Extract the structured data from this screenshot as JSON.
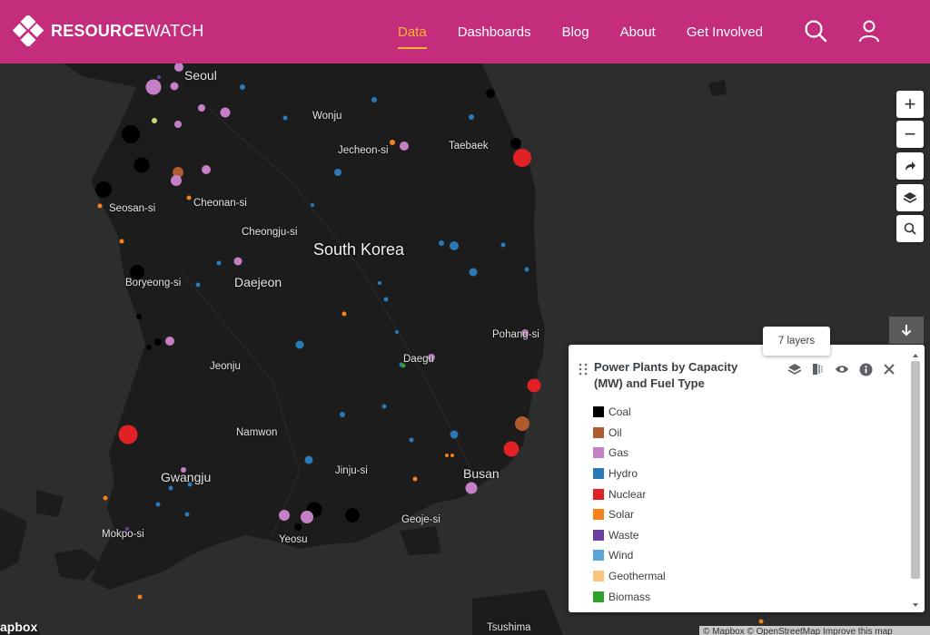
{
  "header": {
    "logo_bold": "RESOURCE",
    "logo_light": "WATCH",
    "nav": [
      "Data",
      "Dashboards",
      "Blog",
      "About",
      "Get Involved"
    ],
    "active_nav": "Data",
    "search_icon": "search-icon",
    "user_icon": "user-icon"
  },
  "map": {
    "labels": {
      "country": "South Korea",
      "seoul": "Seoul",
      "wonju": "Wonju",
      "jecheon": "Jecheon-si",
      "taebaek": "Taebaek",
      "seosan": "Seosan-si",
      "cheonan": "Cheonan-si",
      "cheongju": "Cheongju-si",
      "boryeong": "Boryeong-si",
      "daejeon": "Daejeon",
      "pohang": "Pohang-si",
      "daegu": "Daegu",
      "jeonju": "Jeonju",
      "namwon": "Namwon",
      "jinju": "Jinju-si",
      "busan": "Busan",
      "gwangju": "Gwangju",
      "mokpo": "Mokpo-si",
      "yeosu": "Yeosu",
      "geoje": "Geoje-si",
      "tsushima": "Tsushima"
    },
    "fuel_colors": {
      "Coal": "#000000",
      "Oil": "#b05a2f",
      "Gas": "#c57fc6",
      "Hydro": "#2a7ab7",
      "Nuclear": "#e22127",
      "Solar": "#f7821b",
      "Waste": "#6b3fa0",
      "Wind": "#5aa6d8",
      "Geothermal": "#f9c57a",
      "Biomass": "#2ca12c"
    }
  },
  "controls": {
    "zoom_in": "+",
    "zoom_out": "−",
    "share_icon": "share-icon",
    "layers_icon": "layers-icon",
    "search_icon": "search-icon",
    "collapse_icon": "arrow-down-icon"
  },
  "legend": {
    "title": "Power Plants by Capacity (MW) and Fuel Type",
    "tooltip": "7 layers",
    "items": [
      {
        "label": "Coal",
        "color": "#000000"
      },
      {
        "label": "Oil",
        "color": "#b05a2f"
      },
      {
        "label": "Gas",
        "color": "#c57fc6"
      },
      {
        "label": "Hydro",
        "color": "#2a7ab7"
      },
      {
        "label": "Nuclear",
        "color": "#e22127"
      },
      {
        "label": "Solar",
        "color": "#f7821b"
      },
      {
        "label": "Waste",
        "color": "#6b3fa0"
      },
      {
        "label": "Wind",
        "color": "#5aa6d8"
      },
      {
        "label": "Geothermal",
        "color": "#f9c57a"
      },
      {
        "label": "Biomass",
        "color": "#2ca12c"
      }
    ]
  },
  "attribution": "© Mapbox © OpenStreetMap  Improve this map",
  "mapbox_logo": "apbox"
}
